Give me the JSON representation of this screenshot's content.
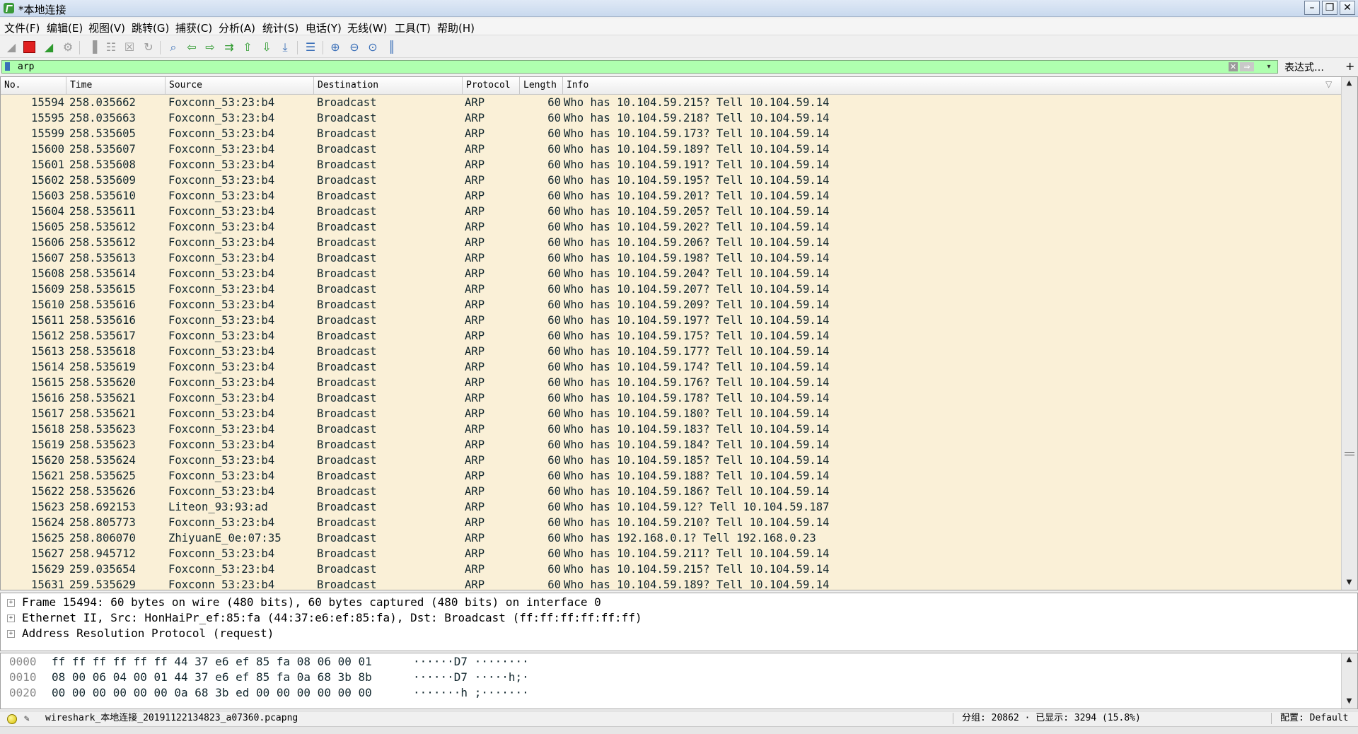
{
  "window": {
    "title": "*本地连接"
  },
  "menu": [
    "文件(F)",
    "编辑(E)",
    "视图(V)",
    "跳转(G)",
    "捕获(C)",
    "分析(A)",
    "统计(S)",
    "电话(Y)",
    "无线(W)",
    "工具(T)",
    "帮助(H)"
  ],
  "filter": {
    "value": "arp",
    "expression_label": "表达式…",
    "add_label": "+"
  },
  "columns": {
    "no": "No.",
    "time": "Time",
    "source": "Source",
    "destination": "Destination",
    "protocol": "Protocol",
    "length": "Length",
    "info": "Info"
  },
  "packets": [
    {
      "no": "15594",
      "time": "258.035662",
      "src": "Foxconn_53:23:b4",
      "dst": "Broadcast",
      "proto": "ARP",
      "len": "60",
      "info": "Who has 10.104.59.215? Tell 10.104.59.14"
    },
    {
      "no": "15595",
      "time": "258.035663",
      "src": "Foxconn_53:23:b4",
      "dst": "Broadcast",
      "proto": "ARP",
      "len": "60",
      "info": "Who has 10.104.59.218? Tell 10.104.59.14"
    },
    {
      "no": "15599",
      "time": "258.535605",
      "src": "Foxconn_53:23:b4",
      "dst": "Broadcast",
      "proto": "ARP",
      "len": "60",
      "info": "Who has 10.104.59.173? Tell 10.104.59.14"
    },
    {
      "no": "15600",
      "time": "258.535607",
      "src": "Foxconn_53:23:b4",
      "dst": "Broadcast",
      "proto": "ARP",
      "len": "60",
      "info": "Who has 10.104.59.189? Tell 10.104.59.14"
    },
    {
      "no": "15601",
      "time": "258.535608",
      "src": "Foxconn_53:23:b4",
      "dst": "Broadcast",
      "proto": "ARP",
      "len": "60",
      "info": "Who has 10.104.59.191? Tell 10.104.59.14"
    },
    {
      "no": "15602",
      "time": "258.535609",
      "src": "Foxconn_53:23:b4",
      "dst": "Broadcast",
      "proto": "ARP",
      "len": "60",
      "info": "Who has 10.104.59.195? Tell 10.104.59.14"
    },
    {
      "no": "15603",
      "time": "258.535610",
      "src": "Foxconn_53:23:b4",
      "dst": "Broadcast",
      "proto": "ARP",
      "len": "60",
      "info": "Who has 10.104.59.201? Tell 10.104.59.14"
    },
    {
      "no": "15604",
      "time": "258.535611",
      "src": "Foxconn_53:23:b4",
      "dst": "Broadcast",
      "proto": "ARP",
      "len": "60",
      "info": "Who has 10.104.59.205? Tell 10.104.59.14"
    },
    {
      "no": "15605",
      "time": "258.535612",
      "src": "Foxconn_53:23:b4",
      "dst": "Broadcast",
      "proto": "ARP",
      "len": "60",
      "info": "Who has 10.104.59.202? Tell 10.104.59.14"
    },
    {
      "no": "15606",
      "time": "258.535612",
      "src": "Foxconn_53:23:b4",
      "dst": "Broadcast",
      "proto": "ARP",
      "len": "60",
      "info": "Who has 10.104.59.206? Tell 10.104.59.14"
    },
    {
      "no": "15607",
      "time": "258.535613",
      "src": "Foxconn_53:23:b4",
      "dst": "Broadcast",
      "proto": "ARP",
      "len": "60",
      "info": "Who has 10.104.59.198? Tell 10.104.59.14"
    },
    {
      "no": "15608",
      "time": "258.535614",
      "src": "Foxconn_53:23:b4",
      "dst": "Broadcast",
      "proto": "ARP",
      "len": "60",
      "info": "Who has 10.104.59.204? Tell 10.104.59.14"
    },
    {
      "no": "15609",
      "time": "258.535615",
      "src": "Foxconn_53:23:b4",
      "dst": "Broadcast",
      "proto": "ARP",
      "len": "60",
      "info": "Who has 10.104.59.207? Tell 10.104.59.14"
    },
    {
      "no": "15610",
      "time": "258.535616",
      "src": "Foxconn_53:23:b4",
      "dst": "Broadcast",
      "proto": "ARP",
      "len": "60",
      "info": "Who has 10.104.59.209? Tell 10.104.59.14"
    },
    {
      "no": "15611",
      "time": "258.535616",
      "src": "Foxconn_53:23:b4",
      "dst": "Broadcast",
      "proto": "ARP",
      "len": "60",
      "info": "Who has 10.104.59.197? Tell 10.104.59.14"
    },
    {
      "no": "15612",
      "time": "258.535617",
      "src": "Foxconn_53:23:b4",
      "dst": "Broadcast",
      "proto": "ARP",
      "len": "60",
      "info": "Who has 10.104.59.175? Tell 10.104.59.14"
    },
    {
      "no": "15613",
      "time": "258.535618",
      "src": "Foxconn_53:23:b4",
      "dst": "Broadcast",
      "proto": "ARP",
      "len": "60",
      "info": "Who has 10.104.59.177? Tell 10.104.59.14"
    },
    {
      "no": "15614",
      "time": "258.535619",
      "src": "Foxconn_53:23:b4",
      "dst": "Broadcast",
      "proto": "ARP",
      "len": "60",
      "info": "Who has 10.104.59.174? Tell 10.104.59.14"
    },
    {
      "no": "15615",
      "time": "258.535620",
      "src": "Foxconn_53:23:b4",
      "dst": "Broadcast",
      "proto": "ARP",
      "len": "60",
      "info": "Who has 10.104.59.176? Tell 10.104.59.14"
    },
    {
      "no": "15616",
      "time": "258.535621",
      "src": "Foxconn_53:23:b4",
      "dst": "Broadcast",
      "proto": "ARP",
      "len": "60",
      "info": "Who has 10.104.59.178? Tell 10.104.59.14"
    },
    {
      "no": "15617",
      "time": "258.535621",
      "src": "Foxconn_53:23:b4",
      "dst": "Broadcast",
      "proto": "ARP",
      "len": "60",
      "info": "Who has 10.104.59.180? Tell 10.104.59.14"
    },
    {
      "no": "15618",
      "time": "258.535623",
      "src": "Foxconn_53:23:b4",
      "dst": "Broadcast",
      "proto": "ARP",
      "len": "60",
      "info": "Who has 10.104.59.183? Tell 10.104.59.14"
    },
    {
      "no": "15619",
      "time": "258.535623",
      "src": "Foxconn_53:23:b4",
      "dst": "Broadcast",
      "proto": "ARP",
      "len": "60",
      "info": "Who has 10.104.59.184? Tell 10.104.59.14"
    },
    {
      "no": "15620",
      "time": "258.535624",
      "src": "Foxconn_53:23:b4",
      "dst": "Broadcast",
      "proto": "ARP",
      "len": "60",
      "info": "Who has 10.104.59.185? Tell 10.104.59.14"
    },
    {
      "no": "15621",
      "time": "258.535625",
      "src": "Foxconn_53:23:b4",
      "dst": "Broadcast",
      "proto": "ARP",
      "len": "60",
      "info": "Who has 10.104.59.188? Tell 10.104.59.14"
    },
    {
      "no": "15622",
      "time": "258.535626",
      "src": "Foxconn_53:23:b4",
      "dst": "Broadcast",
      "proto": "ARP",
      "len": "60",
      "info": "Who has 10.104.59.186? Tell 10.104.59.14"
    },
    {
      "no": "15623",
      "time": "258.692153",
      "src": "Liteon_93:93:ad",
      "dst": "Broadcast",
      "proto": "ARP",
      "len": "60",
      "info": "Who has 10.104.59.12? Tell 10.104.59.187"
    },
    {
      "no": "15624",
      "time": "258.805773",
      "src": "Foxconn_53:23:b4",
      "dst": "Broadcast",
      "proto": "ARP",
      "len": "60",
      "info": "Who has 10.104.59.210? Tell 10.104.59.14"
    },
    {
      "no": "15625",
      "time": "258.806070",
      "src": "ZhiyuanE_0e:07:35",
      "dst": "Broadcast",
      "proto": "ARP",
      "len": "60",
      "info": "Who has 192.168.0.1? Tell 192.168.0.23"
    },
    {
      "no": "15627",
      "time": "258.945712",
      "src": "Foxconn_53:23:b4",
      "dst": "Broadcast",
      "proto": "ARP",
      "len": "60",
      "info": "Who has 10.104.59.211? Tell 10.104.59.14"
    },
    {
      "no": "15629",
      "time": "259.035654",
      "src": "Foxconn_53:23:b4",
      "dst": "Broadcast",
      "proto": "ARP",
      "len": "60",
      "info": "Who has 10.104.59.215? Tell 10.104.59.14"
    },
    {
      "no": "15631",
      "time": "259.535629",
      "src": "Foxconn_53:23:b4",
      "dst": "Broadcast",
      "proto": "ARP",
      "len": "60",
      "info": "Who has 10.104.59.189? Tell 10.104.59.14"
    }
  ],
  "details": [
    "Frame 15494: 60 bytes on wire (480 bits), 60 bytes captured (480 bits) on interface 0",
    "Ethernet II, Src: HonHaiPr_ef:85:fa (44:37:e6:ef:85:fa), Dst: Broadcast (ff:ff:ff:ff:ff:ff)",
    "Address Resolution Protocol (request)"
  ],
  "bytes": [
    {
      "offset": "0000",
      "hex": "ff ff ff ff ff ff 44 37  e6 ef 85 fa 08 06 00 01",
      "ascii": "······D7 ········"
    },
    {
      "offset": "0010",
      "hex": "08 00 06 04 00 01 44 37  e6 ef 85 fa 0a 68 3b 8b",
      "ascii": "······D7 ·····h;·"
    },
    {
      "offset": "0020",
      "hex": "00 00 00 00 00 00 0a 68  3b ed 00 00 00 00 00 00",
      "ascii": "·······h ;·······"
    }
  ],
  "status": {
    "file": "wireshark_本地连接_20191122134823_a07360.pcapng",
    "stats": "分组: 20862 · 已显示: 3294 (15.8%)",
    "profile": "配置: Default"
  },
  "colors": {
    "row_bg": "#faf0d7",
    "filter_ok": "#afffaf",
    "row_text": "#12272e"
  }
}
